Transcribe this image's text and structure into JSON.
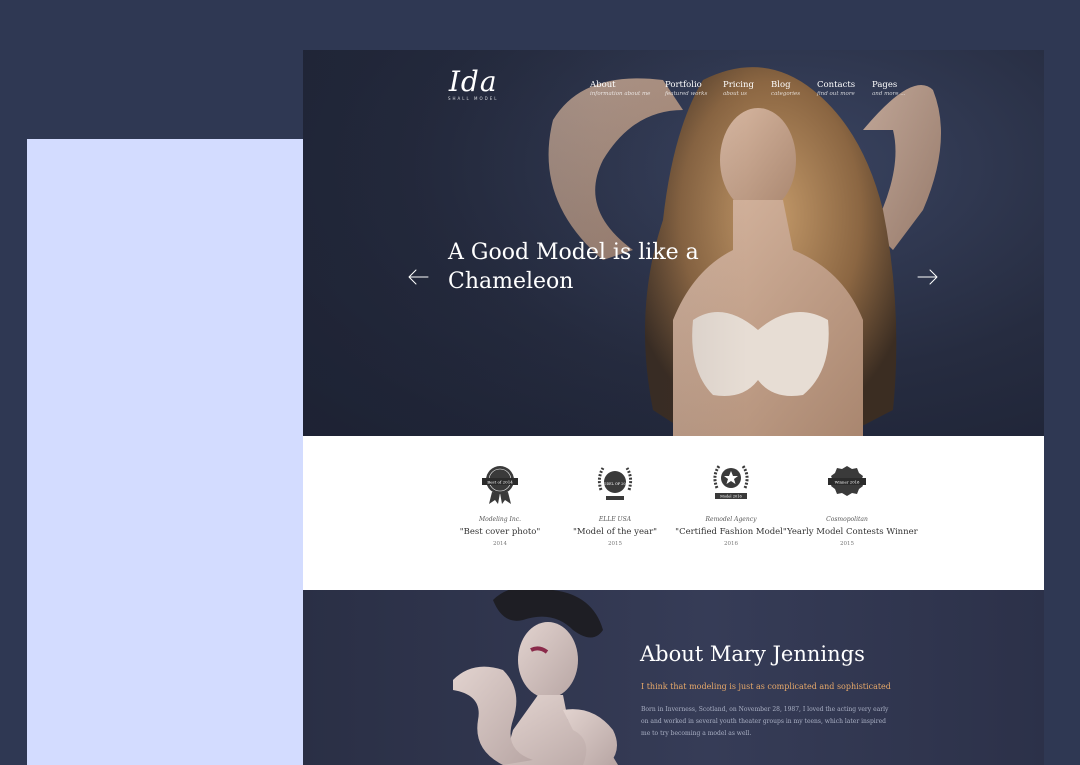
{
  "site": {
    "logo": {
      "mark": "Ida",
      "tagline": "SHALL MODEL"
    },
    "nav": [
      {
        "label": "About",
        "sub": "information about me"
      },
      {
        "label": "Portfolio",
        "sub": "featured works"
      },
      {
        "label": "Pricing",
        "sub": "about us"
      },
      {
        "label": "Blog",
        "sub": "categories"
      },
      {
        "label": "Contacts",
        "sub": "find out more"
      },
      {
        "label": "Pages",
        "sub": "and more ..."
      }
    ],
    "hero": {
      "title": "A Good Model is like a Chameleon"
    },
    "awards": [
      {
        "org": "Modeling Inc.",
        "title": "\"Best cover photo\"",
        "year": "2014",
        "badge_text": "Best of 2014"
      },
      {
        "org": "ELLE USA",
        "title": "\"Model of the year\"",
        "year": "2015",
        "badge_text": "MODEL OF 2016"
      },
      {
        "org": "Remodel Agency",
        "title": "\"Certified Fashion Model\"",
        "year": "2016",
        "badge_text": "Model 2016"
      },
      {
        "org": "Cosmopolitan",
        "title": "Yearly Model Contests Winner",
        "year": "2015",
        "badge_text": "Winner 2016"
      }
    ],
    "about": {
      "title": "About Mary Jennings",
      "lead": "I think that modeling is just as complicated and sophisticated",
      "body": "Born in Inverness, Scotland, on November 28, 1987, I loved the acting very early on and worked in several youth theater groups in my teens, which later inspired me to try becoming a model as well."
    }
  },
  "colors": {
    "page_bg": "#2f3853",
    "side_panel": "#d3dcff",
    "accent": "#e6a86a",
    "about_bg": "#2c3149"
  },
  "icons": [
    "arrow-left-icon",
    "arrow-right-icon",
    "award-badge-icon"
  ]
}
